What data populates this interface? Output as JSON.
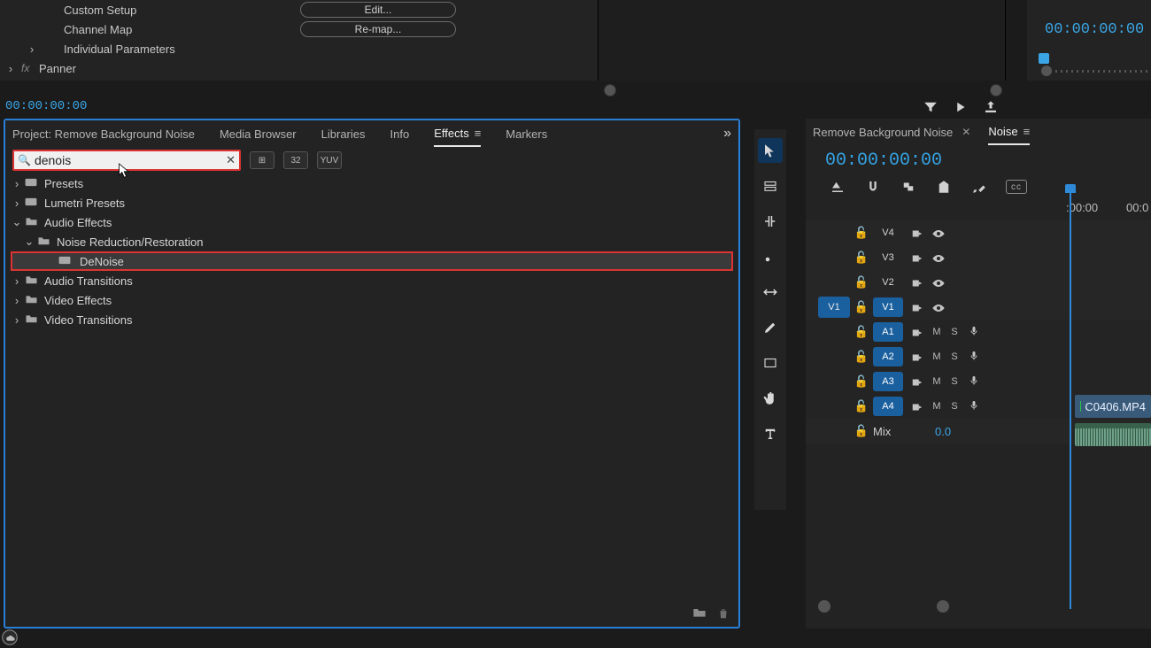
{
  "effect_controls": {
    "rows": [
      {
        "label": "Custom Setup",
        "button": "Edit..."
      },
      {
        "label": "Channel Map",
        "button": "Re-map..."
      },
      {
        "label": "Individual Parameters"
      },
      {
        "label": "Panner"
      }
    ]
  },
  "program_monitor": {
    "timecode": "00:00:00:00"
  },
  "source_timecode": "00:00:00:00",
  "effects_panel": {
    "tabs": [
      {
        "label": "Project: Remove Background Noise",
        "active": false
      },
      {
        "label": "Media Browser",
        "active": false
      },
      {
        "label": "Libraries",
        "active": false
      },
      {
        "label": "Info",
        "active": false
      },
      {
        "label": "Effects",
        "active": true
      },
      {
        "label": "Markers",
        "active": false
      }
    ],
    "search_value": "denois",
    "filter_badges": [
      "⊞",
      "32",
      "YUV"
    ],
    "tree": [
      {
        "label": "Presets",
        "expand": "closed",
        "type": "preset"
      },
      {
        "label": "Lumetri Presets",
        "expand": "closed",
        "type": "preset"
      },
      {
        "label": "Audio Effects",
        "expand": "open",
        "type": "folder"
      },
      {
        "label": "Noise Reduction/Restoration",
        "expand": "open",
        "type": "folder",
        "indent": 1
      },
      {
        "label": "DeNoise",
        "type": "item",
        "indent": 2,
        "highlighted": true
      },
      {
        "label": "Audio Transitions",
        "expand": "closed",
        "type": "folder"
      },
      {
        "label": "Video Effects",
        "expand": "closed",
        "type": "folder"
      },
      {
        "label": "Video Transitions",
        "expand": "closed",
        "type": "folder"
      }
    ]
  },
  "timeline": {
    "tabs": [
      {
        "label": "Remove Background Noise",
        "active": false
      },
      {
        "label": "Noise",
        "active": true
      }
    ],
    "timecode": "00:00:00:00",
    "ruler_ticks": [
      ":00:00",
      "00:0"
    ],
    "cc_label": "cc",
    "video_tracks": [
      {
        "name": "V4"
      },
      {
        "name": "V3"
      },
      {
        "name": "V2"
      },
      {
        "name": "V1",
        "src": "V1",
        "src_on": true,
        "name_on": true
      }
    ],
    "audio_tracks": [
      {
        "name": "A1",
        "name_on": true,
        "mute": "M",
        "solo": "S"
      },
      {
        "name": "A2",
        "name_on": true,
        "mute": "M",
        "solo": "S"
      },
      {
        "name": "A3",
        "name_on": true,
        "mute": "M",
        "solo": "S"
      },
      {
        "name": "A4",
        "name_on": true,
        "mute": "M",
        "solo": "S"
      }
    ],
    "mix": {
      "label": "Mix",
      "value": "0.0"
    },
    "clip_v1": "C0406.MP4"
  }
}
